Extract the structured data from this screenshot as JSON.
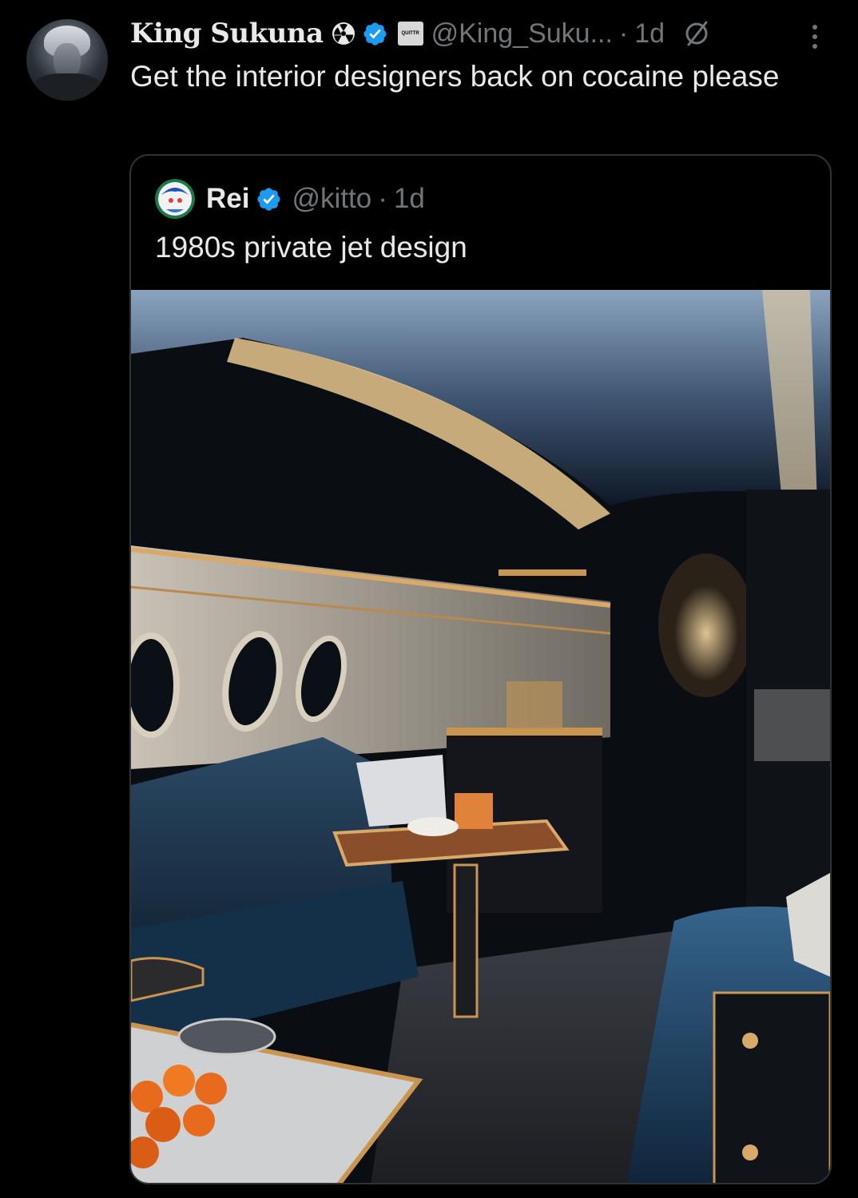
{
  "tweet": {
    "author_name": "King Sukuna",
    "handle": "@King_Suku...",
    "dot": "·",
    "time": "1d",
    "badge_label": "QUITTR",
    "text": "Get the interior designers back on cocaine please",
    "icons": [
      "radiation-icon",
      "verified-icon",
      "quittr-badge",
      "grok-icon",
      "more-icon"
    ]
  },
  "quote": {
    "author_name": "Rei",
    "handle": "@kitto",
    "dot": "·",
    "time": "1d",
    "text": "1980s private jet design"
  },
  "colors": {
    "background": "#000000",
    "text_primary": "#e7e9ea",
    "text_secondary": "#71767b",
    "verified_blue": "#1d9bf0",
    "border": "#2f3336"
  }
}
